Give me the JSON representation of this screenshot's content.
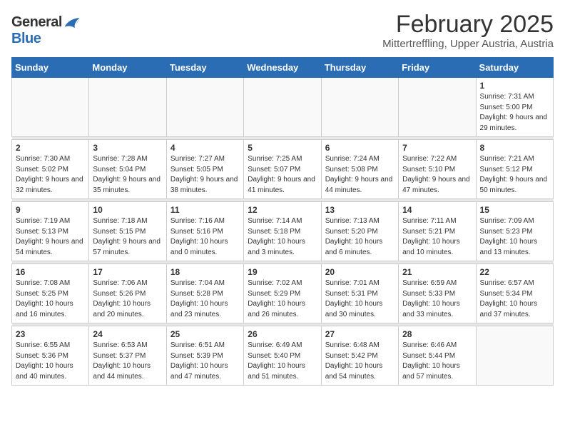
{
  "header": {
    "logo_general": "General",
    "logo_blue": "Blue",
    "title": "February 2025",
    "subtitle": "Mittertreffling, Upper Austria, Austria"
  },
  "weekdays": [
    "Sunday",
    "Monday",
    "Tuesday",
    "Wednesday",
    "Thursday",
    "Friday",
    "Saturday"
  ],
  "weeks": [
    [
      {
        "day": "",
        "info": ""
      },
      {
        "day": "",
        "info": ""
      },
      {
        "day": "",
        "info": ""
      },
      {
        "day": "",
        "info": ""
      },
      {
        "day": "",
        "info": ""
      },
      {
        "day": "",
        "info": ""
      },
      {
        "day": "1",
        "info": "Sunrise: 7:31 AM\nSunset: 5:00 PM\nDaylight: 9 hours and 29 minutes."
      }
    ],
    [
      {
        "day": "2",
        "info": "Sunrise: 7:30 AM\nSunset: 5:02 PM\nDaylight: 9 hours and 32 minutes."
      },
      {
        "day": "3",
        "info": "Sunrise: 7:28 AM\nSunset: 5:04 PM\nDaylight: 9 hours and 35 minutes."
      },
      {
        "day": "4",
        "info": "Sunrise: 7:27 AM\nSunset: 5:05 PM\nDaylight: 9 hours and 38 minutes."
      },
      {
        "day": "5",
        "info": "Sunrise: 7:25 AM\nSunset: 5:07 PM\nDaylight: 9 hours and 41 minutes."
      },
      {
        "day": "6",
        "info": "Sunrise: 7:24 AM\nSunset: 5:08 PM\nDaylight: 9 hours and 44 minutes."
      },
      {
        "day": "7",
        "info": "Sunrise: 7:22 AM\nSunset: 5:10 PM\nDaylight: 9 hours and 47 minutes."
      },
      {
        "day": "8",
        "info": "Sunrise: 7:21 AM\nSunset: 5:12 PM\nDaylight: 9 hours and 50 minutes."
      }
    ],
    [
      {
        "day": "9",
        "info": "Sunrise: 7:19 AM\nSunset: 5:13 PM\nDaylight: 9 hours and 54 minutes."
      },
      {
        "day": "10",
        "info": "Sunrise: 7:18 AM\nSunset: 5:15 PM\nDaylight: 9 hours and 57 minutes."
      },
      {
        "day": "11",
        "info": "Sunrise: 7:16 AM\nSunset: 5:16 PM\nDaylight: 10 hours and 0 minutes."
      },
      {
        "day": "12",
        "info": "Sunrise: 7:14 AM\nSunset: 5:18 PM\nDaylight: 10 hours and 3 minutes."
      },
      {
        "day": "13",
        "info": "Sunrise: 7:13 AM\nSunset: 5:20 PM\nDaylight: 10 hours and 6 minutes."
      },
      {
        "day": "14",
        "info": "Sunrise: 7:11 AM\nSunset: 5:21 PM\nDaylight: 10 hours and 10 minutes."
      },
      {
        "day": "15",
        "info": "Sunrise: 7:09 AM\nSunset: 5:23 PM\nDaylight: 10 hours and 13 minutes."
      }
    ],
    [
      {
        "day": "16",
        "info": "Sunrise: 7:08 AM\nSunset: 5:25 PM\nDaylight: 10 hours and 16 minutes."
      },
      {
        "day": "17",
        "info": "Sunrise: 7:06 AM\nSunset: 5:26 PM\nDaylight: 10 hours and 20 minutes."
      },
      {
        "day": "18",
        "info": "Sunrise: 7:04 AM\nSunset: 5:28 PM\nDaylight: 10 hours and 23 minutes."
      },
      {
        "day": "19",
        "info": "Sunrise: 7:02 AM\nSunset: 5:29 PM\nDaylight: 10 hours and 26 minutes."
      },
      {
        "day": "20",
        "info": "Sunrise: 7:01 AM\nSunset: 5:31 PM\nDaylight: 10 hours and 30 minutes."
      },
      {
        "day": "21",
        "info": "Sunrise: 6:59 AM\nSunset: 5:33 PM\nDaylight: 10 hours and 33 minutes."
      },
      {
        "day": "22",
        "info": "Sunrise: 6:57 AM\nSunset: 5:34 PM\nDaylight: 10 hours and 37 minutes."
      }
    ],
    [
      {
        "day": "23",
        "info": "Sunrise: 6:55 AM\nSunset: 5:36 PM\nDaylight: 10 hours and 40 minutes."
      },
      {
        "day": "24",
        "info": "Sunrise: 6:53 AM\nSunset: 5:37 PM\nDaylight: 10 hours and 44 minutes."
      },
      {
        "day": "25",
        "info": "Sunrise: 6:51 AM\nSunset: 5:39 PM\nDaylight: 10 hours and 47 minutes."
      },
      {
        "day": "26",
        "info": "Sunrise: 6:49 AM\nSunset: 5:40 PM\nDaylight: 10 hours and 51 minutes."
      },
      {
        "day": "27",
        "info": "Sunrise: 6:48 AM\nSunset: 5:42 PM\nDaylight: 10 hours and 54 minutes."
      },
      {
        "day": "28",
        "info": "Sunrise: 6:46 AM\nSunset: 5:44 PM\nDaylight: 10 hours and 57 minutes."
      },
      {
        "day": "",
        "info": ""
      }
    ]
  ]
}
